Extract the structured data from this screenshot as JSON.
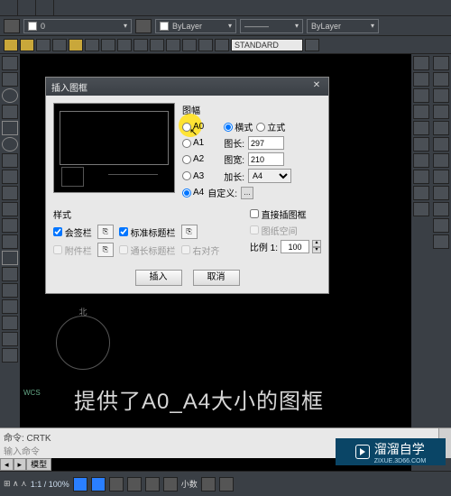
{
  "ribbon": {
    "bylayer1": "ByLayer",
    "bylayer2": "ByLayer",
    "standard": "STANDARD"
  },
  "dialog": {
    "title": "插入图框",
    "frame_group": "图幅",
    "sizes": {
      "a0": "A0",
      "a1": "A1",
      "a2": "A2",
      "a3": "A3",
      "a4": "A4"
    },
    "orient": {
      "h": "横式",
      "v": "立式"
    },
    "length_label": "图长:",
    "length_val": "297",
    "width_label": "图宽:",
    "width_val": "210",
    "extend_label": "加长:",
    "extend_val": "A4",
    "custom_label": "自定义:",
    "style_group": "样式",
    "cb_sig": "会签栏",
    "cb_std": "标准标题栏",
    "cb_att": "附件栏",
    "cb_long": "通长标题栏",
    "cb_right": "右对齐",
    "opt_direct": "直接插图框",
    "opt_paper": "图纸空间",
    "scale_label": "比例 1:",
    "scale_val": "100",
    "btn_insert": "插入",
    "btn_cancel": "取消"
  },
  "canvas": {
    "caption": "提供了A0_A4大小的图框",
    "compass_n": "北",
    "ucs": "WCS"
  },
  "cmd": {
    "line1": "命令: CRTK",
    "line2": "输入命令"
  },
  "tabs": {
    "model": "模型"
  },
  "status": {
    "coords": "1:1 / 100%",
    "decimal": "小数"
  },
  "watermark": {
    "main": "溜溜自学",
    "sub": "ZIXUE.3D66.COM"
  }
}
